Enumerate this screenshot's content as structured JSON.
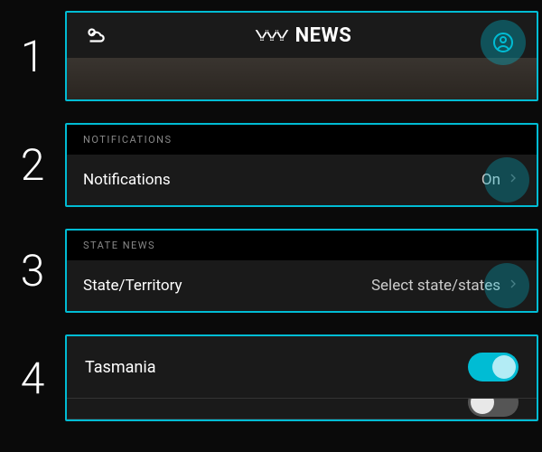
{
  "steps": {
    "s1": "1",
    "s2": "2",
    "s3": "3",
    "s4": "4"
  },
  "header": {
    "brand_text": "NEWS"
  },
  "notifications": {
    "section_label": "NOTIFICATIONS",
    "row_label": "Notifications",
    "row_value": "On"
  },
  "state_news": {
    "section_label": "STATE NEWS",
    "row_label": "State/Territory",
    "row_value": "Select state/states"
  },
  "states": {
    "item1_label": "Tasmania",
    "item1_on": true
  },
  "colors": {
    "accent": "#00bcd4",
    "bg": "#0a0a0a",
    "panel": "#1a1a1a"
  }
}
